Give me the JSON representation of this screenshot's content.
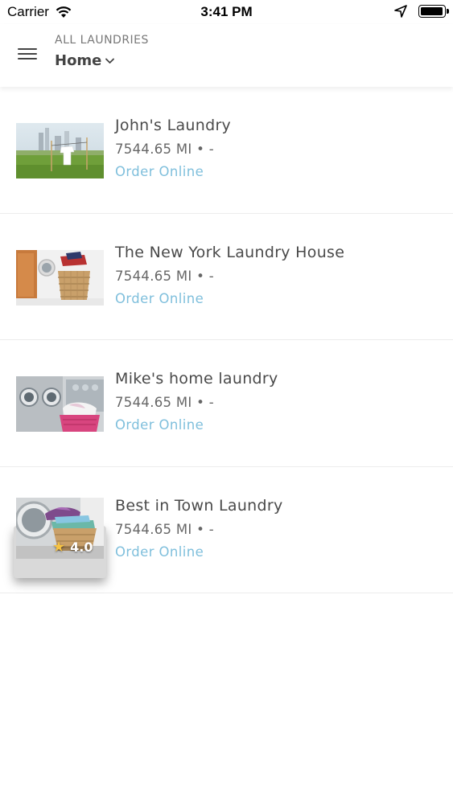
{
  "status_bar": {
    "carrier": "Carrier",
    "time": "3:41 PM"
  },
  "header": {
    "overline": "ALL LAUNDRIES",
    "location": "Home"
  },
  "laundries": [
    {
      "name": "John's Laundry",
      "distance": "7544.65 MI • -",
      "action": "Order Online",
      "rating": ""
    },
    {
      "name": "The New York Laundry House",
      "distance": "7544.65 MI • -",
      "action": "Order Online",
      "rating": ""
    },
    {
      "name": "Mike's home laundry",
      "distance": "7544.65 MI • -",
      "action": "Order Online",
      "rating": ""
    },
    {
      "name": "Best in Town Laundry",
      "distance": "7544.65 MI • -",
      "action": "Order Online",
      "rating": "4.0"
    }
  ],
  "colors": {
    "link": "#7fbfdc",
    "star": "#f6c343",
    "divider": "#ececec"
  },
  "icons": [
    "wifi-icon",
    "location-arrow-icon",
    "battery-icon",
    "menu-icon",
    "chevron-down-icon",
    "star-icon"
  ]
}
